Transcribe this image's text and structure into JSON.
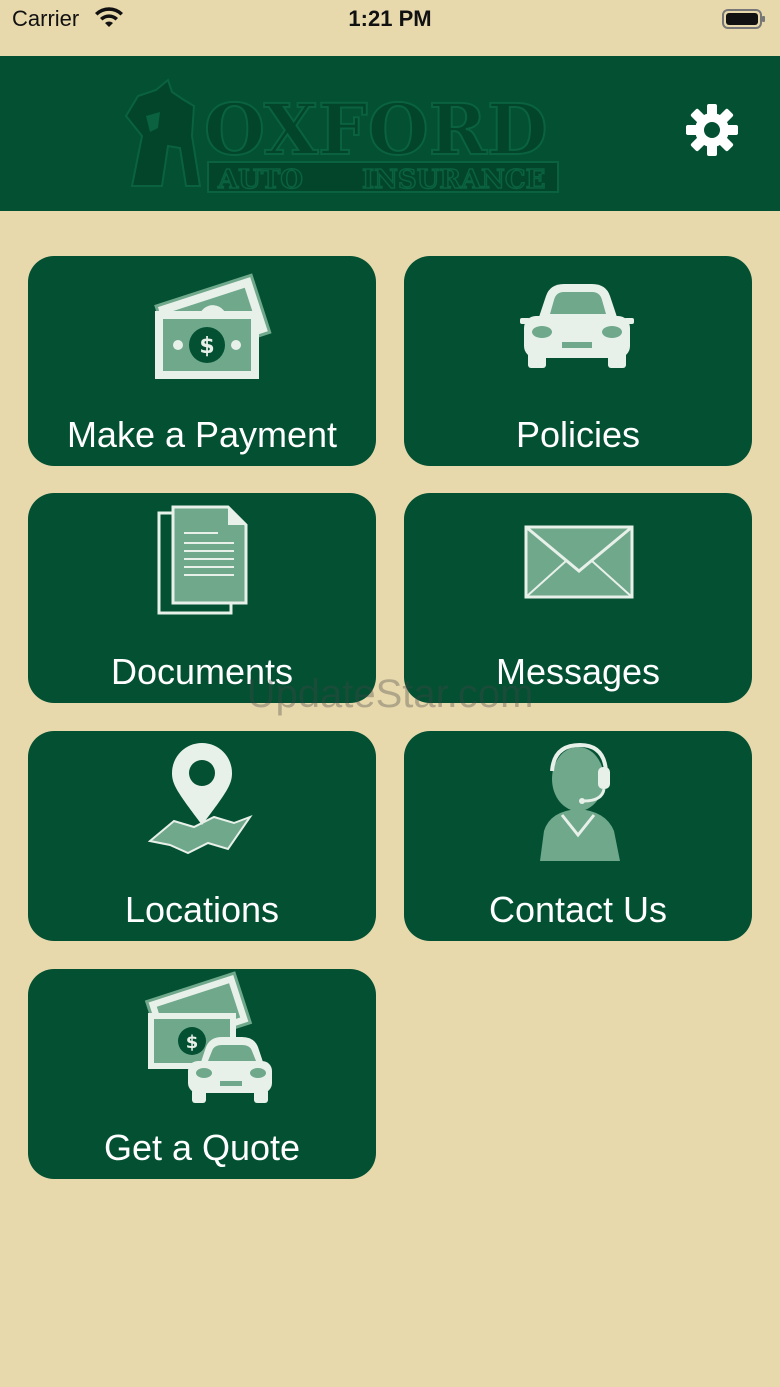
{
  "status_bar": {
    "carrier": "Carrier",
    "time": "1:21 PM"
  },
  "header": {
    "logo_main": "OXFORD",
    "logo_left": "AUTO",
    "logo_right": "INSURANCE",
    "settings_icon": "gear-icon"
  },
  "colors": {
    "background": "#e8d9ad",
    "brand_green": "#035033",
    "icon_tint": "#6fa88a"
  },
  "tiles": [
    {
      "label": "Make a Payment",
      "icon": "money-icon"
    },
    {
      "label": "Policies",
      "icon": "car-icon"
    },
    {
      "label": "Documents",
      "icon": "document-icon"
    },
    {
      "label": "Messages",
      "icon": "envelope-icon"
    },
    {
      "label": "Locations",
      "icon": "map-pin-icon"
    },
    {
      "label": "Contact Us",
      "icon": "headset-agent-icon"
    },
    {
      "label": "Get a Quote",
      "icon": "money-car-icon"
    }
  ],
  "watermark": "UpdateStar.com"
}
